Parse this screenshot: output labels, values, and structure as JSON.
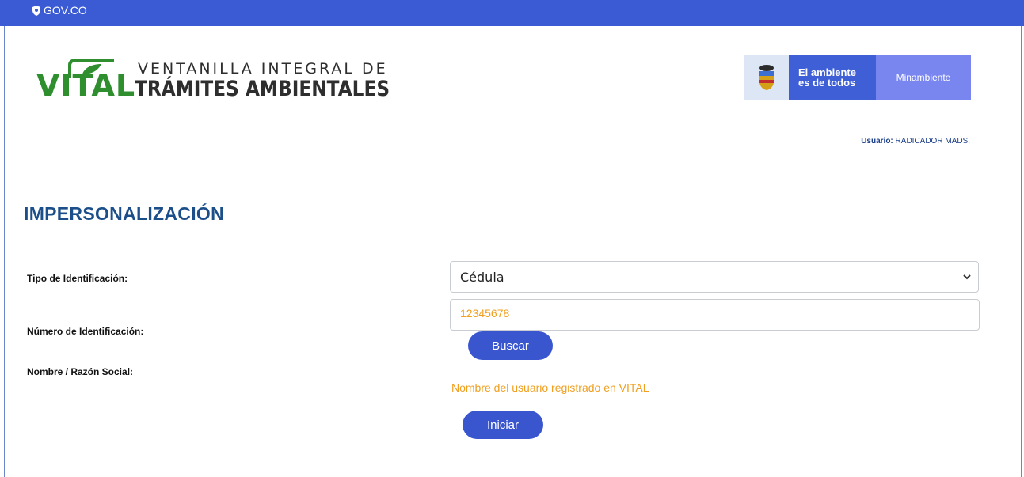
{
  "topbar": {
    "gov_label": "GOV.CO"
  },
  "logo": {
    "word": "VITAL",
    "line1": "VENTANILLA INTEGRAL DE",
    "line2": "TRÁMITES AMBIENTALES"
  },
  "ministry": {
    "slogan_line1": "El ambiente",
    "slogan_line2": "es de todos",
    "name": "Minambiente"
  },
  "user": {
    "label": "Usuario:",
    "value": "RADICADOR MADS."
  },
  "page": {
    "title": "IMPERSONALIZACIÓN"
  },
  "form": {
    "tipo_label": "Tipo de Identificación:",
    "tipo_value": "Cédula",
    "numero_label": "Número de Identificación:",
    "numero_value": "12345678",
    "buscar_label": "Buscar",
    "nombre_label": "Nombre / Razón Social:",
    "nombre_value": "Nombre del usuario registrado en VITAL",
    "iniciar_label": "Iniciar"
  },
  "colors": {
    "topbar": "#3b5bd4",
    "accent_orange": "#f0a020",
    "button": "#3a56cf",
    "title": "#1c4e8a"
  },
  "icons": [
    "shield-icon",
    "vital-leaf-icon",
    "colombia-coat-of-arms-icon",
    "chevron-down-icon"
  ]
}
